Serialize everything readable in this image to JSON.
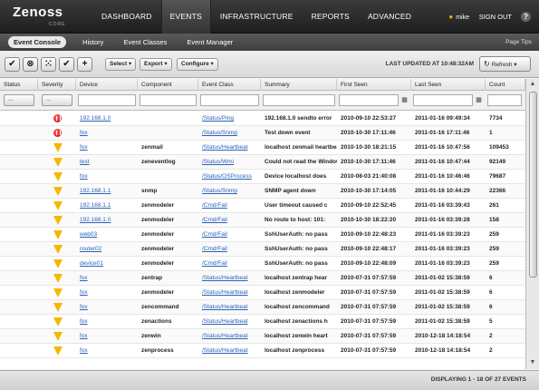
{
  "brand": {
    "name": "Zenoss",
    "edition": "CORE"
  },
  "nav": [
    "DASHBOARD",
    "EVENTS",
    "INFRASTRUCTURE",
    "REPORTS",
    "ADVANCED"
  ],
  "user": {
    "name": "mike",
    "signout": "SIGN OUT",
    "help": "?"
  },
  "subnav": {
    "items": [
      "Event Console",
      "History",
      "Event Classes",
      "Event Manager"
    ],
    "page_tips": "Page Tips"
  },
  "toolbar": {
    "buttons": {
      "acknowledge": "✔",
      "close": "⊗",
      "classify": "⁙",
      "reopen": "✔",
      "add": "+"
    },
    "select": "Select ▾",
    "export": "Export ▾",
    "configure": "Configure ▾",
    "last_updated": "LAST UPDATED AT 10:48:32AM",
    "refresh": "Refresh ▾"
  },
  "columns": [
    "Status",
    "Severity",
    "Device",
    "Component",
    "Event Class",
    "Summary",
    "First Seen",
    "Last Seen",
    "Count"
  ],
  "filters": {
    "status": "...",
    "severity": "..."
  },
  "events": [
    {
      "sev": "critical",
      "device": "192.168.1.0",
      "component": "",
      "eclass": "/Status/Ping",
      "summary": "192.168.1.0 sendto error",
      "first": "2010-09-10 22:53:27",
      "last": "2011-01-16 09:49:34",
      "count": "7734"
    },
    {
      "sev": "critical",
      "device": "fox",
      "component": "",
      "eclass": "/Status/Snmp",
      "summary": "Test down event",
      "first": "2010-10-30 17:11:46",
      "last": "2011-01-16 17:11:46",
      "count": "1"
    },
    {
      "sev": "warning",
      "device": "fox",
      "component": "zenmail",
      "eclass": "/Status/Heartbeat",
      "summary": "localhost zenmail heartbeat",
      "first": "2010-10-30 18:21:15",
      "last": "2011-01-16 10:47:56",
      "count": "109453"
    },
    {
      "sev": "warning",
      "device": "test",
      "component": "zeneventlog",
      "eclass": "/Status/Wmi",
      "summary": "Could not read the Windows",
      "first": "2010-10-30 17:11:46",
      "last": "2011-01-16 10:47:44",
      "count": "92149"
    },
    {
      "sev": "warning",
      "device": "fox",
      "component": "",
      "eclass": "/Status/OSProcess",
      "summary": "Device localhost does",
      "first": "2010-08-03 21:40:08",
      "last": "2011-01-16 10:46:46",
      "count": "79687"
    },
    {
      "sev": "warning",
      "device": "192.168.1.1",
      "component": "snmp",
      "eclass": "/Status/Snmp",
      "summary": "SNMP agent down",
      "first": "2010-10-30 17:14:05",
      "last": "2011-01-16 10:44:29",
      "count": "22366"
    },
    {
      "sev": "warning",
      "device": "192.168.1.1",
      "component": "zenmodeler",
      "eclass": "/Cmd/Fail",
      "summary": "User timeout caused c",
      "first": "2010-09-10 22:52:45",
      "last": "2011-01-16 03:39:43",
      "count": "261"
    },
    {
      "sev": "warning",
      "device": "192.168.1.0",
      "component": "zenmodeler",
      "eclass": "/Cmd/Fail",
      "summary": "No route to host: 101:",
      "first": "2010-10-30 18:22:20",
      "last": "2011-01-16 03:39:28",
      "count": "158"
    },
    {
      "sev": "warning",
      "device": "web03",
      "component": "zenmodeler",
      "eclass": "/Cmd/Fail",
      "summary": "SshUserAuth: no pass",
      "first": "2010-09-10 22:48:23",
      "last": "2011-01-16 03:39:23",
      "count": "259"
    },
    {
      "sev": "warning",
      "device": "router02",
      "component": "zenmodeler",
      "eclass": "/Cmd/Fail",
      "summary": "SshUserAuth: no pass",
      "first": "2010-09-10 22:48:17",
      "last": "2011-01-16 03:39:23",
      "count": "259"
    },
    {
      "sev": "warning",
      "device": "device01",
      "component": "zenmodeler",
      "eclass": "/Cmd/Fail",
      "summary": "SshUserAuth: no pass",
      "first": "2010-09-10 22:48:09",
      "last": "2011-01-16 03:39:23",
      "count": "259"
    },
    {
      "sev": "warning",
      "device": "fox",
      "component": "zentrap",
      "eclass": "/Status/Heartbeat",
      "summary": "localhost zentrap hear",
      "first": "2010-07-31 07:57:59",
      "last": "2011-01-02 15:38:59",
      "count": "6"
    },
    {
      "sev": "warning",
      "device": "fox",
      "component": "zenmodeler",
      "eclass": "/Status/Heartbeat",
      "summary": "localhost zenmodeler",
      "first": "2010-07-31 07:57:59",
      "last": "2011-01-02 15:38:59",
      "count": "6"
    },
    {
      "sev": "warning",
      "device": "fox",
      "component": "zencommand",
      "eclass": "/Status/Heartbeat",
      "summary": "localhost zencommand",
      "first": "2010-07-31 07:57:59",
      "last": "2011-01-02 15:38:59",
      "count": "6"
    },
    {
      "sev": "warning",
      "device": "fox",
      "component": "zenactions",
      "eclass": "/Status/Heartbeat",
      "summary": "localhost zenactions h",
      "first": "2010-07-31 07:57:59",
      "last": "2011-01-02 15:38:59",
      "count": "5"
    },
    {
      "sev": "warning",
      "device": "fox",
      "component": "zenwin",
      "eclass": "/Status/Heartbeat",
      "summary": "localhost zenwin heart",
      "first": "2010-07-31 07:57:59",
      "last": "2010-12-18 14:18:54",
      "count": "2"
    },
    {
      "sev": "warning",
      "device": "fox",
      "component": "zenprocess",
      "eclass": "/Status/Heartbeat",
      "summary": "localhost zenprocess",
      "first": "2010-07-31 07:57:59",
      "last": "2010-12-18 14:18:54",
      "count": "2"
    }
  ],
  "footer": {
    "display": "DISPLAYING 1 - 18 OF 27 EVENTS"
  }
}
